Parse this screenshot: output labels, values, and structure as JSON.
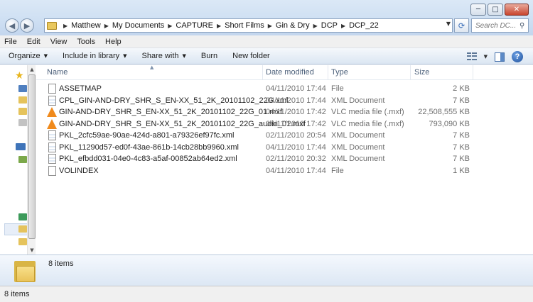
{
  "window": {
    "minimize_glyph": "─",
    "maximize_glyph": "□",
    "close_glyph": "✕"
  },
  "navigation": {
    "back_glyph": "◀",
    "forward_glyph": "▶"
  },
  "address": {
    "crumbs": [
      "Matthew",
      "My Documents",
      "CAPTURE",
      "Short Films",
      "Gin & Dry",
      "DCP",
      "DCP_22"
    ],
    "separator": "▶",
    "dropdown_glyph": "▼",
    "refresh_glyph": "⟳"
  },
  "search": {
    "placeholder": "Search DC...",
    "icon_glyph": "⚲"
  },
  "menu": {
    "items": [
      "File",
      "Edit",
      "View",
      "Tools",
      "Help"
    ]
  },
  "toolbar": {
    "organize": "Organize",
    "include_in_library": "Include in library",
    "share_with": "Share with",
    "burn": "Burn",
    "new_folder": "New folder",
    "dropdown_glyph": "▼",
    "help_glyph": "?"
  },
  "columns": {
    "name": "Name",
    "date_modified": "Date modified",
    "type": "Type",
    "size": "Size",
    "sort_caret": "▲"
  },
  "files": [
    {
      "name": "ASSETMAP",
      "date": "04/11/2010 17:44",
      "type": "File",
      "size": "2 KB",
      "icon": "generic-file-icon"
    },
    {
      "name": "CPL_GIN-AND-DRY_SHR_S_EN-XX_51_2K_20101102_22G.xml",
      "date": "04/11/2010 17:44",
      "type": "XML Document",
      "size": "7 KB",
      "icon": "xml-document-icon"
    },
    {
      "name": "GIN-AND-DRY_SHR_S_EN-XX_51_2K_20101102_22G_01.mxf",
      "date": "04/11/2010 17:42",
      "type": "VLC media file (.mxf)",
      "size": "22,508,555 KB",
      "icon": "vlc-media-icon"
    },
    {
      "name": "GIN-AND-DRY_SHR_S_EN-XX_51_2K_20101102_22G_audio_01.mxf",
      "date": "04/11/2010 17:42",
      "type": "VLC media file (.mxf)",
      "size": "793,090 KB",
      "icon": "vlc-media-icon"
    },
    {
      "name": "PKL_2cfc59ae-90ae-424d-a801-a79326ef97fc.xml",
      "date": "02/11/2010 20:54",
      "type": "XML Document",
      "size": "7 KB",
      "icon": "xml-document-icon"
    },
    {
      "name": "PKL_11290d57-ed0f-43ae-861b-14cb28bb9960.xml",
      "date": "04/11/2010 17:44",
      "type": "XML Document",
      "size": "7 KB",
      "icon": "xml-document-icon"
    },
    {
      "name": "PKL_efbdd031-04e0-4c83-a5af-00852ab64ed2.xml",
      "date": "02/11/2010 20:32",
      "type": "XML Document",
      "size": "7 KB",
      "icon": "xml-document-icon"
    },
    {
      "name": "VOLINDEX",
      "date": "04/11/2010 17:44",
      "type": "File",
      "size": "1 KB",
      "icon": "generic-file-icon"
    }
  ],
  "scroll_glyphs": {
    "up": "▲",
    "down": "▼"
  },
  "details": {
    "item_count": "8 items"
  },
  "status": {
    "item_count": "8 items"
  }
}
